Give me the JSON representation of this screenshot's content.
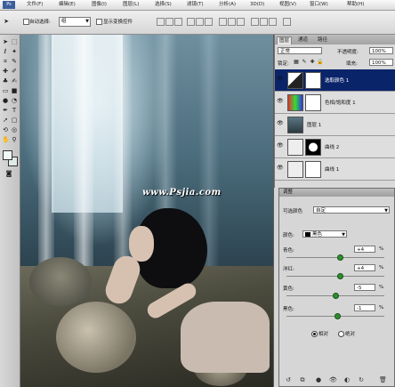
{
  "menubar": {
    "logo": "Ps",
    "items": [
      "文件(F)",
      "编辑(E)",
      "图像(I)",
      "图层(L)",
      "选择(S)",
      "滤镜(T)",
      "分析(A)",
      "3D(D)",
      "视图(V)",
      "窗口(W)",
      "帮助(H)"
    ]
  },
  "options": {
    "auto_select_label": "自动选择:",
    "auto_select_value": "组",
    "show_transform_label": "显示变换控件"
  },
  "canvas": {
    "watermark": "www.Psjia.com"
  },
  "layers_panel": {
    "tabs": [
      "图层",
      "通道",
      "路径"
    ],
    "blend_mode": "正常",
    "opacity_label": "不透明度:",
    "opacity_value": "100%",
    "lock_label": "锁定:",
    "fill_label": "填充:",
    "fill_value": "100%",
    "layers": [
      {
        "name": "选取颜色 1",
        "selected": true
      },
      {
        "name": "色相/饱和度 1",
        "selected": false
      },
      {
        "name": "图层 1",
        "selected": false
      },
      {
        "name": "曲线 2",
        "selected": false
      },
      {
        "name": "曲线 1",
        "selected": false
      }
    ]
  },
  "adjustments": {
    "header": "调整",
    "preset_label": "可选颜色",
    "preset_value": "自定",
    "colors_label": "颜色:",
    "colors_value": "黑色",
    "cyan_label": "青色:",
    "cyan_value": "+4",
    "cyan_unit": "%",
    "magenta_label": "洋红:",
    "magenta_value": "+4",
    "magenta_unit": "%",
    "yellow_label": "黄色:",
    "yellow_value": "-5",
    "yellow_unit": "%",
    "black_label": "黑色:",
    "black_value": "-1",
    "black_unit": "%",
    "relative_label": "相对",
    "absolute_label": "绝对"
  }
}
